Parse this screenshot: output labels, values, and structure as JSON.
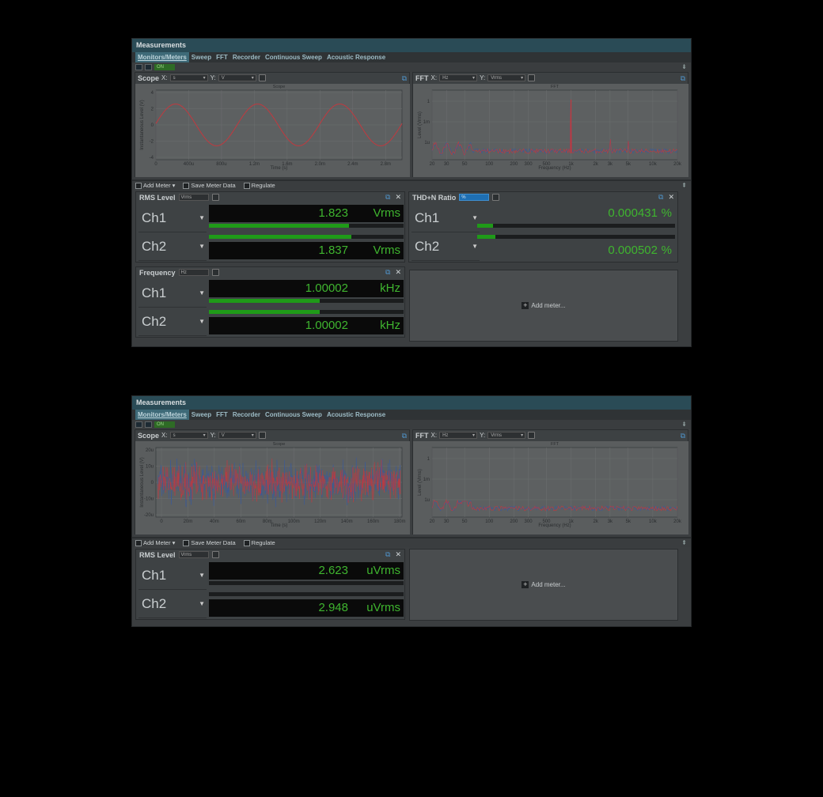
{
  "window": {
    "title": "Measurements",
    "menu": [
      "Monitors/Meters",
      "Sweep",
      "FFT",
      "Recorder",
      "Continuous Sweep",
      "Acoustic Response"
    ],
    "on_label": "ON"
  },
  "toolbar": {
    "add_meter": "Add Meter",
    "save_meter_data": "Save Meter Data",
    "regulate": "Regulate"
  },
  "add_meter_placeholder": "Add meter...",
  "scope": {
    "label": "Scope",
    "x_axis_label": "X:",
    "x_unit": "s",
    "y_axis_label": "Y:",
    "y_unit": "V"
  },
  "fft": {
    "label": "FFT",
    "x_axis_label": "X:",
    "x_unit": "Hz",
    "y_axis_label": "Y:",
    "y_unit": "Vrms"
  },
  "chart_data": [
    {
      "type": "line",
      "title": "Scope",
      "xlabel": "Time (s)",
      "ylabel": "Instantaneous Level (V)",
      "xticks": [
        "0",
        "400u",
        "800u",
        "1.2m",
        "1.6m",
        "2.0m",
        "2.4m",
        "2.8m"
      ],
      "yticks": [
        "4",
        "2",
        "0",
        "-2",
        "-4"
      ],
      "ylim": [
        -4,
        4
      ],
      "xlim": [
        0,
        0.003
      ],
      "series": [
        {
          "amplitude_v": 2.58,
          "frequency_hz": 1000
        }
      ]
    },
    {
      "type": "line",
      "title": "FFT",
      "xlabel": "Frequency (Hz)",
      "ylabel": "Level (Vrms)",
      "xticks": [
        "20",
        "30",
        "50",
        "100",
        "200",
        "300",
        "500",
        "1k",
        "2k",
        "3k",
        "5k",
        "10k",
        "20k"
      ],
      "yticks": [
        "1",
        "1m",
        "1u"
      ],
      "peak_hz": 1000,
      "peak_vrms": 1.8
    },
    {
      "type": "line",
      "title": "Scope",
      "xlabel": "Time (s)",
      "ylabel": "Instantaneous Level (V)",
      "xticks": [
        "0",
        "20m",
        "40m",
        "60m",
        "80m",
        "100m",
        "120m",
        "140m",
        "160m",
        "180m"
      ],
      "yticks": [
        "20u",
        "10u",
        "0",
        "-10u",
        "-20u"
      ],
      "ylim": [
        -2e-05,
        2e-05
      ]
    },
    {
      "type": "line",
      "title": "FFT",
      "xlabel": "Frequency (Hz)",
      "ylabel": "Level (Vrms)",
      "xticks": [
        "20",
        "30",
        "50",
        "100",
        "200",
        "300",
        "500",
        "1k",
        "2k",
        "3k",
        "5k",
        "10k",
        "20k"
      ],
      "yticks": [
        "1",
        "1m",
        "1u"
      ]
    }
  ],
  "screen1": {
    "rms": {
      "title": "RMS Level",
      "unit_select": "Vrms",
      "ch1": {
        "name": "Ch1",
        "value": "1.823",
        "unit": "Vrms",
        "level": 0.72
      },
      "ch2": {
        "name": "Ch2",
        "value": "1.837",
        "unit": "Vrms",
        "level": 0.73
      }
    },
    "thdn": {
      "title": "THD+N Ratio",
      "unit_select": "%",
      "ch1": {
        "name": "Ch1",
        "value": "0.000431",
        "unit": "%",
        "level": 0.08
      },
      "ch2": {
        "name": "Ch2",
        "value": "0.000502",
        "unit": "%",
        "level": 0.09
      }
    },
    "freq": {
      "title": "Frequency",
      "unit_select": "Hz",
      "ch1": {
        "name": "Ch1",
        "value": "1.00002",
        "unit": "kHz",
        "level": 0.57
      },
      "ch2": {
        "name": "Ch2",
        "value": "1.00002",
        "unit": "kHz",
        "level": 0.57
      }
    }
  },
  "screen2": {
    "rms": {
      "title": "RMS Level",
      "unit_select": "Vrms",
      "ch1": {
        "name": "Ch1",
        "value": "2.623",
        "unit": "uVrms",
        "level": 0.0
      },
      "ch2": {
        "name": "Ch2",
        "value": "2.948",
        "unit": "uVrms",
        "level": 0.0
      }
    }
  },
  "colors": {
    "ch1": "#c0393f",
    "ch2": "#3a5a9a",
    "meter_green": "#3fb52f",
    "title_bar": "#2a4b56"
  }
}
